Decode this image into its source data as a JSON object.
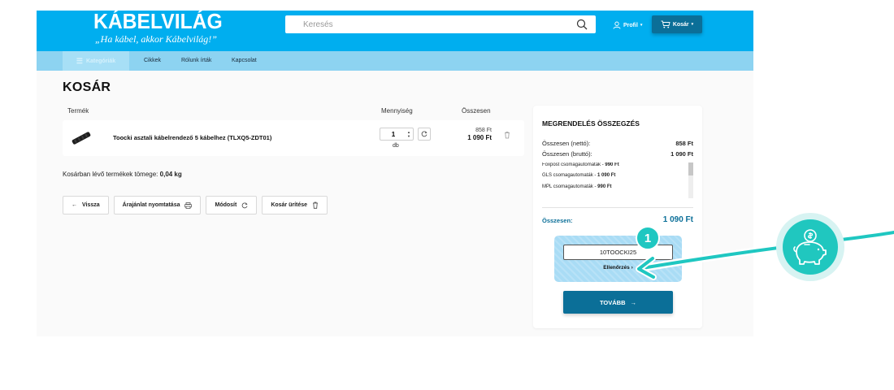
{
  "header": {
    "logo_text": "KÁBELVILÁG",
    "logo_tagline": "„Ha kábel, akkor Kábelvilág!”",
    "search_placeholder": "Keresés",
    "profile_label": "Profil",
    "cart_label": "Kosár",
    "color_primary": "#00aeef",
    "color_dark": "#0b6f98"
  },
  "nav": {
    "categories_label": "Kategóriák",
    "links": [
      "Cikkek",
      "Rólunk írták",
      "Kapcsolat"
    ]
  },
  "cart": {
    "title": "KOSÁR",
    "columns": {
      "product": "Termék",
      "quantity": "Mennyiség",
      "total": "Összesen"
    },
    "item": {
      "name": "Toocki asztali kábelrendező 5 kábelhez (TLXQ5-ZDT01)",
      "quantity": "1",
      "unit": "db",
      "unit_price": "858 Ft",
      "total_price": "1 090 Ft"
    },
    "weight_label": "Kosárban lévő termékek tömege:",
    "weight_value": "0,04 kg",
    "buttons": {
      "back": "Vissza",
      "print_quote": "Árajánlat nyomtatása",
      "modify": "Módosít",
      "empty": "Kosár ürítése"
    }
  },
  "summary": {
    "title": "MEGRENDELÉS ÖSSZEGZÉS",
    "net_label": "Összesen (nettó):",
    "net_value": "858 Ft",
    "gross_label": "Összesen (bruttó):",
    "gross_value": "1 090 Ft",
    "shipping": [
      {
        "name": "Foxpost csomagautomaták -",
        "price": "990 Ft"
      },
      {
        "name": "GLS csomagautomaták -",
        "price": "1 090 Ft"
      },
      {
        "name": "MPL csomagautomaták -",
        "price": "990 Ft"
      }
    ],
    "total_label": "Összesen:",
    "total_value": "1 090 Ft",
    "coupon_value": "10TOOCKI25",
    "coupon_check": "Ellenőrzés",
    "step_number": "1",
    "continue_label": "TOVÁBB",
    "accent": "#1fc7c1"
  }
}
